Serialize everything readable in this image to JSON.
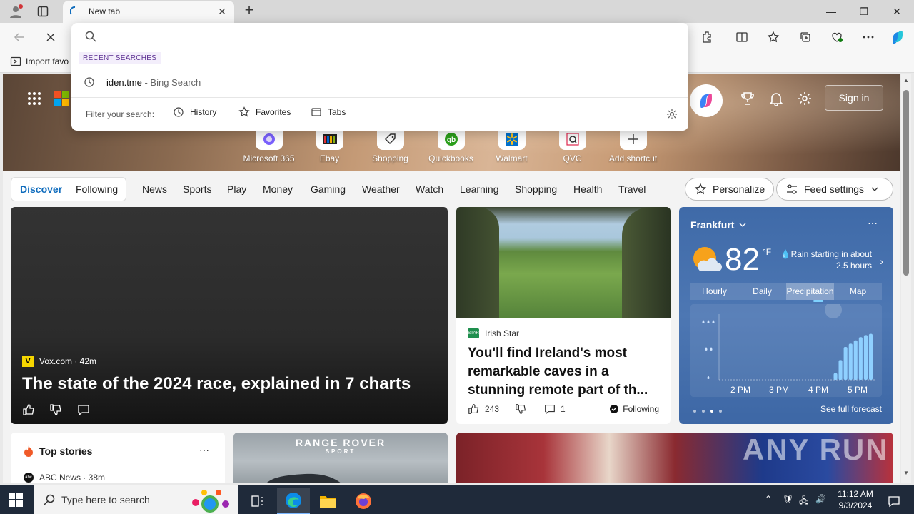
{
  "browser": {
    "tab": {
      "title": "New tab"
    },
    "favorites_bar": {
      "import_label": "Import favo"
    }
  },
  "address_dropdown": {
    "recent_label": "RECENT SEARCHES",
    "recent": [
      {
        "query": "iden.tme",
        "engine": " - Bing Search"
      }
    ],
    "filter_label": "Filter your search:",
    "filters": [
      "History",
      "Favorites",
      "Tabs"
    ]
  },
  "header": {
    "sign_in": "Sign in"
  },
  "shortcuts": [
    "Microsoft 365",
    "Ebay",
    "Shopping",
    "Quickbooks",
    "Walmart",
    "QVC",
    "Add shortcut"
  ],
  "nav": {
    "discover": "Discover",
    "following": "Following",
    "items": [
      "News",
      "Sports",
      "Play",
      "Money",
      "Gaming",
      "Weather",
      "Watch",
      "Learning",
      "Shopping",
      "Health",
      "Travel"
    ],
    "personalize": "Personalize",
    "feed_settings": "Feed settings"
  },
  "hero_article": {
    "source": "Vox.com · 42m",
    "title": "The state of the 2024 race, explained in 7 charts"
  },
  "ireland_article": {
    "source": "Irish Star",
    "title": "You'll find Ireland's most remarkable caves in a stunning remote part of th...",
    "likes": "243",
    "comments": "1",
    "following": "Following"
  },
  "weather": {
    "city": "Frankfurt",
    "temp": "82",
    "unit": "°F",
    "rain_note": "Rain starting in about 2.5 hours",
    "tabs": [
      "Hourly",
      "Daily",
      "Precipitation",
      "Map"
    ],
    "selected_tab": "Precipitation",
    "times": [
      "2 PM",
      "3 PM",
      "4 PM",
      "5 PM"
    ],
    "precip_levels": [
      0,
      0,
      0,
      0,
      0,
      0,
      0,
      0,
      0,
      0,
      0,
      0,
      0,
      0,
      0,
      0,
      0,
      0,
      0,
      0,
      0,
      0,
      0.1,
      0.3,
      0.5,
      0.55,
      0.6,
      0.65,
      0.68,
      0.7
    ],
    "see_forecast": "See full forecast"
  },
  "top_stories": {
    "title": "Top stories",
    "source": "ABC News · 38m"
  },
  "ad": {
    "line1": "RANGE ROVER",
    "line2": "SPORT"
  },
  "watermark": "ANY RUN",
  "taskbar": {
    "search_placeholder": "Type here to search",
    "time": "11:12 AM",
    "date": "9/3/2024"
  },
  "colors": {
    "accent": "#0f6cbd",
    "weather_bg": "#4670ad",
    "taskbar": "#1f2a3a"
  }
}
